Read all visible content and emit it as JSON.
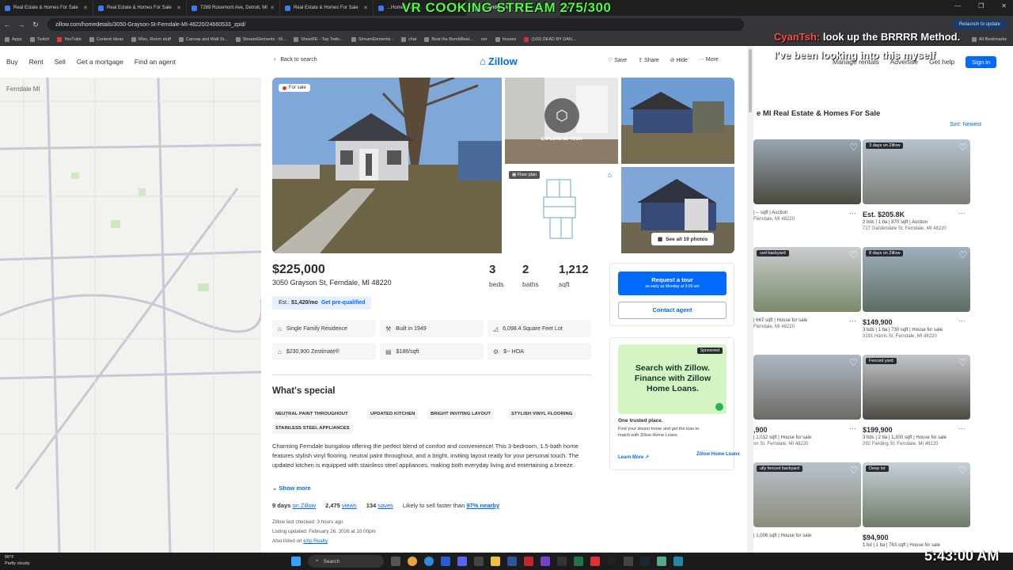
{
  "stream_title": "VR COOKING STREAM 275/300",
  "browser": {
    "tabs": [
      {
        "label": "Real Estate & Homes For Sale"
      },
      {
        "label": "Real Estate & Homes For Sale"
      },
      {
        "label": "7289 Rosemont Ave, Detroit, MI"
      },
      {
        "label": "Real Estate & Homes For Sale"
      },
      {
        "label": "...Home Loans..."
      },
      {
        "label": "...Ferndale, MI"
      }
    ],
    "url": "zillow.com/homedetails/3050-Grayson-St-Ferndale-MI-48220/24660533_zpid/",
    "relaunch": "Relaunch to update",
    "bookmarks": [
      "Apps",
      "Twitch",
      "YouTube",
      "Content Ideas",
      "Misc. Room stuff",
      "Canvas and Wall St...",
      "StreamElements - M...",
      "SheetFE - Top Twitc...",
      "StreamElements -",
      "chat",
      "Beat the BombBeat...",
      "oor",
      "houses",
      "(103) DEAD BY DAN..."
    ],
    "all_bookmarks": "All Bookmarks"
  },
  "chat": {
    "user": "CyanTsh:",
    "message": " look up the BRRRR Method. I've been looking into this myself"
  },
  "background": {
    "nav": [
      "Buy",
      "Rent",
      "Sell",
      "Get a mortgage",
      "Find an agent"
    ],
    "search_value": "Ferndale MI",
    "right_nav": [
      "Manage rentals",
      "Advertise",
      "Get help"
    ],
    "sign_in": "Sign in",
    "list_title": "e MI Real Estate & Homes For Sale",
    "sort": "Sort: Newest",
    "cards": [
      {
        "tag": "",
        "price": "",
        "meta": "| -- sqft | Auction",
        "addr": "Ferndale, MI 48220"
      },
      {
        "tag": "3 days on Zillow",
        "price": "Est. $205.8K",
        "meta": "2 bds | 1 ba | 870 sqft | Auction",
        "addr": "727 Gardendale St, Ferndale, MI 48220"
      },
      {
        "tag": "ced backyard",
        "price": "",
        "meta": "| 667 sqft | House for sale",
        "addr": "Ferndale, MI 48220"
      },
      {
        "tag": "8 days on Zillow",
        "price": "$149,900",
        "meta": "3 bds | 1 ba | 730 sqft | House for sale",
        "addr": "3191 Harris St, Ferndale, MI 48220"
      },
      {
        "tag": "",
        "price": ",900",
        "meta": "| 1,012 sqft | House for sale",
        "addr": "on St, Ferndale, MI 48220"
      },
      {
        "tag": "Fenced yard",
        "price": "$199,900",
        "meta": "3 bds | 2 ba | 1,300 sqft | House for sale",
        "addr": "292 Fielding St, Ferndale, MI 48220"
      },
      {
        "tag": "ully fenced backyard",
        "price": "",
        "meta": "| 1,006 sqft | House for sale",
        "addr": ""
      },
      {
        "tag": "Deep lot",
        "price": "$94,900",
        "meta": "1 bd | 1 ba | 763 sqft | House for sale",
        "addr": ""
      }
    ]
  },
  "modal": {
    "back": "Back to search",
    "logo": "Zillow",
    "actions": [
      "Save",
      "Share",
      "Hide",
      "More"
    ],
    "for_sale": "For sale",
    "tour_label": "EXPLORE 3D TOUR",
    "floor_plan": "Floor plan",
    "see_all": "See all 19 photos",
    "price": "$225,000",
    "address": "3050 Grayson St, Ferndale, MI 48220",
    "beds": {
      "value": "3",
      "label": "beds"
    },
    "baths": {
      "value": "2",
      "label": "baths"
    },
    "sqft": {
      "value": "1,212",
      "label": "sqft"
    },
    "est_prefix": "Est.:",
    "est_value": "$1,420/mo",
    "prequal": "Get pre-qualified",
    "facts": [
      {
        "icon": "home-icon",
        "text": "Single Family Residence"
      },
      {
        "icon": "hammer-icon",
        "text": "Built in 1949"
      },
      {
        "icon": "ruler-icon",
        "text": "6,098.4 Square Feet Lot"
      },
      {
        "icon": "zestimate-icon",
        "text": "$230,900 Zestimate®"
      },
      {
        "icon": "price-sqft-icon",
        "text": "$186/sqft"
      },
      {
        "icon": "hoa-icon",
        "text": "$-- HOA"
      }
    ],
    "special_heading": "What's special",
    "chips": [
      "NEUTRAL PAINT THROUGHOUT",
      "UPDATED KITCHEN",
      "BRIGHT INVITING LAYOUT",
      "STYLISH VINYL FLOORING",
      "STAINLESS STEEL APPLIANCES"
    ],
    "description": "Charming Ferndale bungalow offering the perfect blend of comfort and convenience! This 3-bedroom, 1.5-bath home features stylish vinyl flooring, neutral paint throughout, and a bright, inviting layout ready for your personal touch. The updated kitchen is equipped with stainless steel appliances, making both everyday living and entertaining a breeze.",
    "show_more": "Show more",
    "days": "9 days",
    "on_zillow": "on Zillow",
    "views_n": "2,475",
    "views": "views",
    "saves_n": "134",
    "saves": "saves",
    "likely": "Likely to sell faster than",
    "likely_pct": "97% nearby",
    "last_checked": "Zillow last checked: 3 hours ago",
    "listing_updated": "Listing updated: February 26, 2026 at 10:00pm",
    "also_listed": "Also listed on",
    "also_listed_link": "eXp Realty",
    "request_tour": "Request a tour",
    "tour_sub": "as early as Monday at 9:00 am",
    "contact_agent": "Contact agent",
    "ad": {
      "sponsored": "Sponsored",
      "headline": "Search with Zillow. Finance with Zillow Home Loans.",
      "subhead": "One trusted place.",
      "body": "Find your dream home and get the loan to match with Zillow Home Loans.",
      "learn_more": "Learn More",
      "logo": "Zillow Home Loans"
    }
  },
  "taskbar": {
    "temp": "56°F",
    "weather": "Partly cloudy",
    "search": "Search",
    "time": "5:43:00 AM"
  },
  "colors": {
    "accent": "#006aff",
    "stream_green": "#4eff3a"
  }
}
